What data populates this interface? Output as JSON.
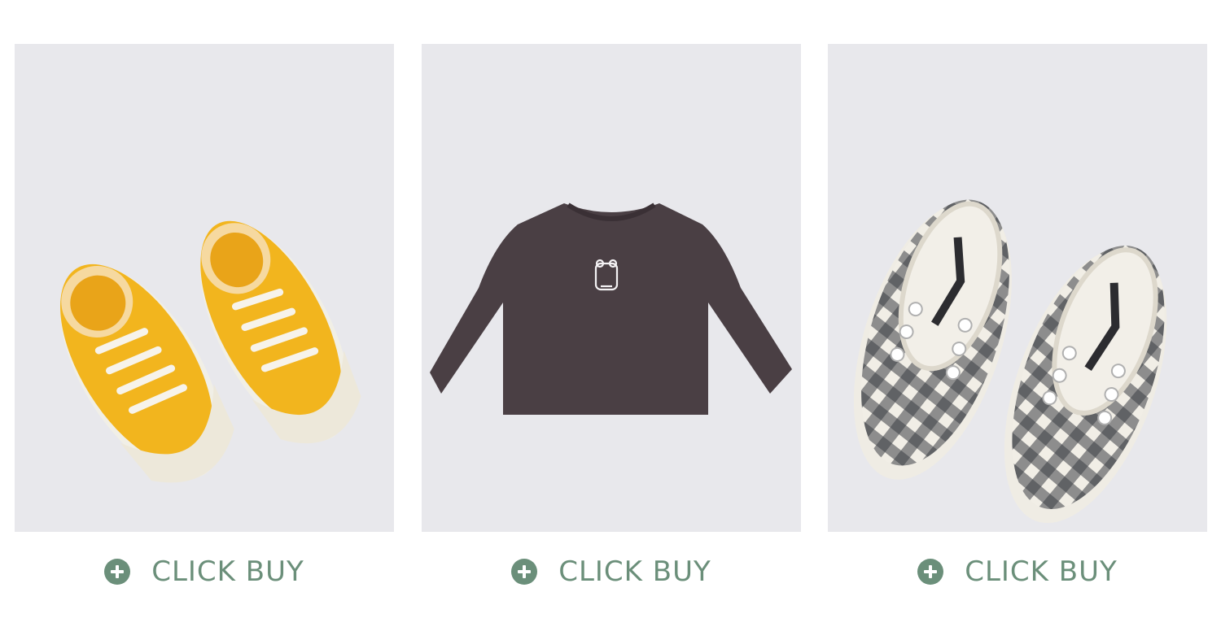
{
  "products": [
    {
      "name": "Yellow canvas sneakers",
      "image_icon": "yellow-sneakers-image",
      "button_label": "CLICK BUY"
    },
    {
      "name": "Dark long-sleeve tee",
      "image_icon": "dark-longsleeve-tshirt-image",
      "button_label": "CLICK BUY"
    },
    {
      "name": "Plaid slip-on shoes",
      "image_icon": "plaid-slipon-shoes-image",
      "button_label": "CLICK BUY"
    }
  ],
  "colors": {
    "photo_bg": "#e8e8ec",
    "accent": "#6b8f7a",
    "sneaker_yellow": "#f2b51e",
    "tshirt": "#4a3f44"
  }
}
